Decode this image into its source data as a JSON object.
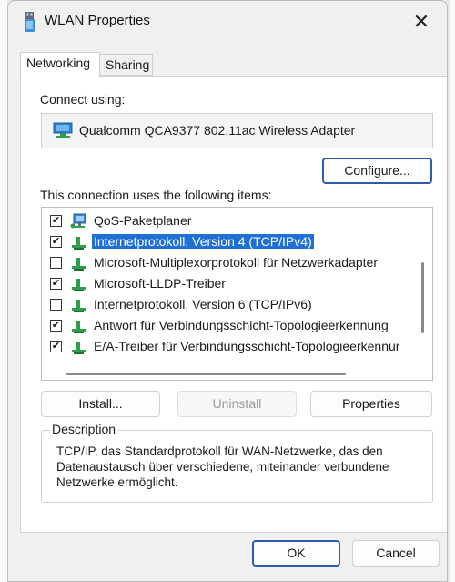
{
  "window": {
    "title": "WLAN Properties",
    "close_glyph": "✕"
  },
  "tabs": [
    {
      "label": "Networking",
      "active": true
    },
    {
      "label": "Sharing",
      "active": false
    }
  ],
  "connect": {
    "label": "Connect using:",
    "adapter": "Qualcomm QCA9377 802.11ac Wireless Adapter",
    "configure_label": "Configure..."
  },
  "items": {
    "label": "This connection uses the following items:",
    "rows": [
      {
        "label": "QoS-Paketplaner",
        "checked": true,
        "icon": "network-monitor-icon"
      },
      {
        "label": "Internetprotokoll, Version 4 (TCP/IPv4)",
        "checked": true,
        "icon": "protocol-icon",
        "selected": true
      },
      {
        "label": "Microsoft-Multiplexorprotokoll für Netzwerkadapter",
        "checked": false,
        "icon": "protocol-icon"
      },
      {
        "label": "Microsoft-LLDP-Treiber",
        "checked": true,
        "icon": "protocol-icon"
      },
      {
        "label": "Internetprotokoll, Version 6 (TCP/IPv6)",
        "checked": false,
        "icon": "protocol-icon"
      },
      {
        "label": "Antwort für Verbindungsschicht-Topologieerkennung",
        "checked": true,
        "icon": "protocol-icon"
      },
      {
        "label": "E/A-Treiber für Verbindungsschicht-Topologieerkennur",
        "checked": true,
        "icon": "protocol-icon"
      }
    ]
  },
  "actions": {
    "install": "Install...",
    "uninstall": "Uninstall",
    "properties": "Properties"
  },
  "description": {
    "legend": "Description",
    "text": "TCP/IP, das Standardprotokoll für WAN-Netzwerke, das den Datenaustausch über verschiedene, miteinander verbundene Netzwerke ermöglicht."
  },
  "footer": {
    "ok": "OK",
    "cancel": "Cancel"
  },
  "colors": {
    "selection": "#1f6fd6",
    "primary_border": "#2a5db0"
  }
}
